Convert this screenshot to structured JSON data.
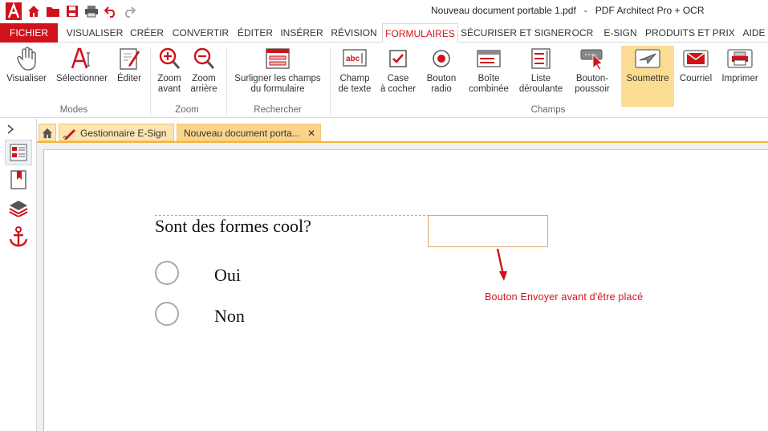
{
  "window": {
    "title": "Nouveau document portable 1.pdf   -   PDF Architect Pro + OCR"
  },
  "menu": {
    "file": "FICHIER",
    "tabs": [
      "VISUALISER",
      "CRÉER",
      "CONVERTIR",
      "ÉDITER",
      "INSÉRER",
      "RÉVISION",
      "FORMULAIRES",
      "SÉCURISER ET SIGNER",
      "OCR",
      "E-SIGN",
      "PRODUITS ET PRIX",
      "AIDE"
    ],
    "active_tab": "FORMULAIRES"
  },
  "ribbon": {
    "modes": {
      "label": "Modes",
      "view": "Visualiser",
      "select": "Sélectionner",
      "edit": "Éditer"
    },
    "zoom": {
      "label": "Zoom",
      "zoom_in_1": "Zoom",
      "zoom_in_2": "avant",
      "zoom_out_1": "Zoom",
      "zoom_out_2": "arrière"
    },
    "search": {
      "label": "Rechercher",
      "highlight_1": "Surligner les champs",
      "highlight_2": "du formulaire"
    },
    "fields": {
      "label": "Champs",
      "text_1": "Champ",
      "text_2": "de texte",
      "check_1": "Case",
      "check_2": "à cocher",
      "radio_1": "Bouton",
      "radio_2": "radio",
      "combo_1": "Boîte",
      "combo_2": "combinée",
      "list_1": "Liste",
      "list_2": "déroulante",
      "push_1": "Bouton-",
      "push_2": "poussoir",
      "submit": "Soumettre",
      "email": "Courriel",
      "print": "Imprimer"
    }
  },
  "doc_tabs": {
    "home_icon": "home-icon",
    "esign": "Gestionnaire E-Sign",
    "doc": "Nouveau document porta..."
  },
  "document": {
    "question": "Sont des formes cool?",
    "options": [
      "Oui",
      "Non"
    ],
    "annotation": "Bouton Envoyer avant d'être placé"
  },
  "colors": {
    "brand_red": "#d0121b",
    "highlight": "#fcdc92",
    "tab_orange": "#f4b43a"
  }
}
